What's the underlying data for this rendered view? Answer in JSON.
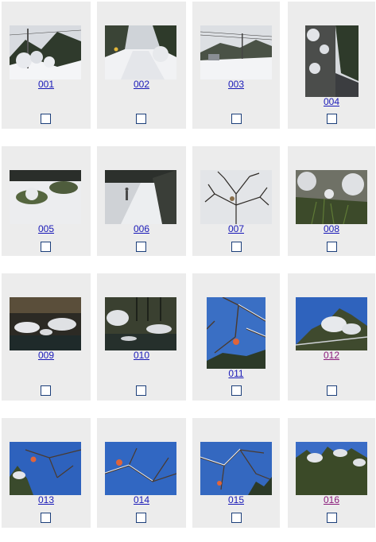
{
  "colors": {
    "cell_background": "#ececec",
    "link": "#1a1ab8",
    "visited_link": "#8a1a7a",
    "checkbox_border": "#1c3f7a"
  },
  "gallery": {
    "items": [
      {
        "label": "001",
        "visited": false,
        "checked": false,
        "scene": "snowy-mountain-road-with-poles"
      },
      {
        "label": "002",
        "visited": false,
        "checked": false,
        "scene": "snowy-road-with-sign"
      },
      {
        "label": "003",
        "visited": false,
        "checked": false,
        "scene": "snowy-valley-power-lines"
      },
      {
        "label": "004",
        "visited": false,
        "checked": false,
        "scene": "stone-wall-snowy-road"
      },
      {
        "label": "005",
        "visited": false,
        "checked": false,
        "scene": "snow-covered-shrubs"
      },
      {
        "label": "006",
        "visited": false,
        "checked": false,
        "scene": "snowy-path-with-figure"
      },
      {
        "label": "007",
        "visited": false,
        "checked": false,
        "scene": "bare-branches-grey-sky"
      },
      {
        "label": "008",
        "visited": false,
        "checked": false,
        "scene": "snowy-rocks-and-grass"
      },
      {
        "label": "009",
        "visited": false,
        "checked": false,
        "scene": "snowy-stream-rocks"
      },
      {
        "label": "010",
        "visited": false,
        "checked": false,
        "scene": "snowy-river-trees"
      },
      {
        "label": "011",
        "visited": false,
        "checked": false,
        "scene": "persimmon-branch-blue-sky"
      },
      {
        "label": "012",
        "visited": true,
        "checked": false,
        "scene": "snowy-pine-blue-sky"
      },
      {
        "label": "013",
        "visited": false,
        "checked": false,
        "scene": "persimmon-snowy-branches"
      },
      {
        "label": "014",
        "visited": false,
        "checked": false,
        "scene": "persimmon-snowy-branches"
      },
      {
        "label": "015",
        "visited": false,
        "checked": false,
        "scene": "snowy-branches-blue-sky"
      },
      {
        "label": "016",
        "visited": true,
        "checked": false,
        "scene": "snowy-tree-blue-sky"
      }
    ]
  }
}
